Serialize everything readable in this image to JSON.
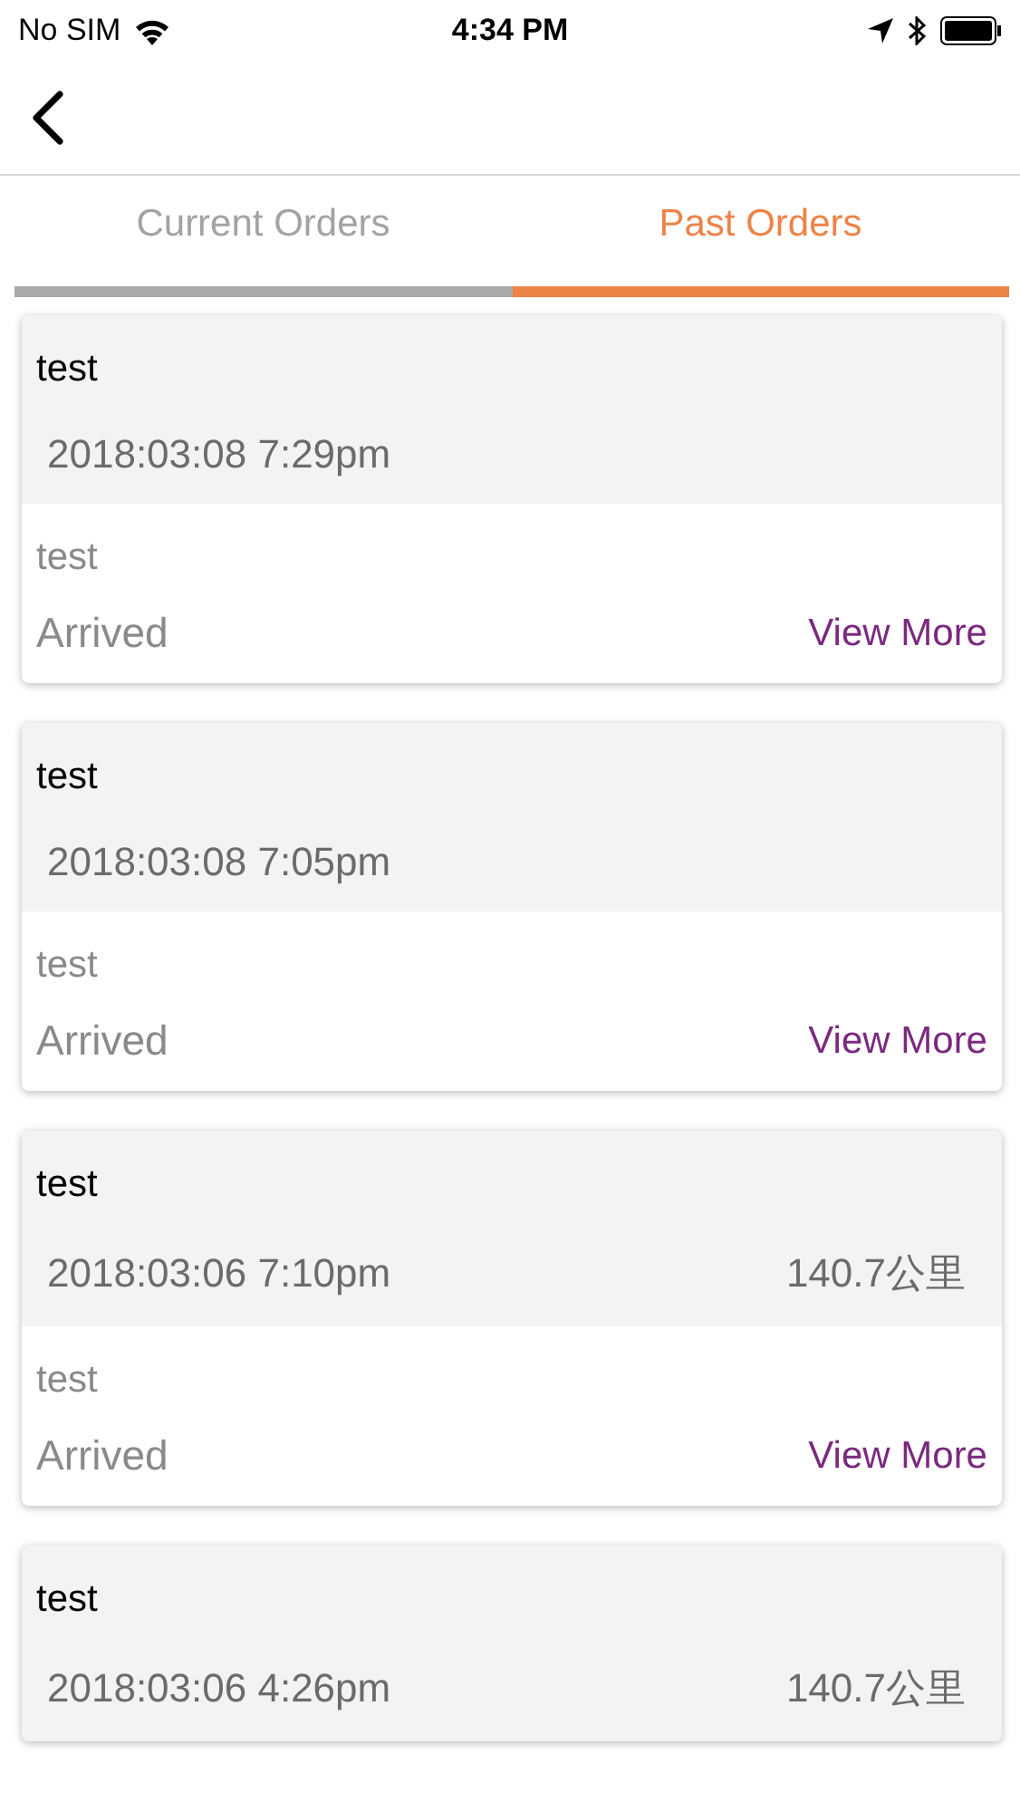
{
  "status_bar": {
    "carrier": "No SIM",
    "time": "4:34 PM"
  },
  "tabs": [
    {
      "label": "Current Orders",
      "selected": false
    },
    {
      "label": "Past Orders",
      "selected": true
    }
  ],
  "orders": [
    {
      "title": "test",
      "datetime": "2018:03:08 7:29pm",
      "note": "test",
      "status": "Arrived",
      "action": "View More"
    },
    {
      "title": "test",
      "datetime": "2018:03:08 7:05pm",
      "note": "test",
      "status": "Arrived",
      "action": "View More"
    },
    {
      "title": "test",
      "datetime": "2018:03:06 7:10pm",
      "distance": "140.7公里",
      "note": "test",
      "status": "Arrived",
      "action": "View More"
    },
    {
      "title": "test",
      "datetime": "2018:03:06 4:26pm",
      "distance": "140.7公里"
    }
  ]
}
